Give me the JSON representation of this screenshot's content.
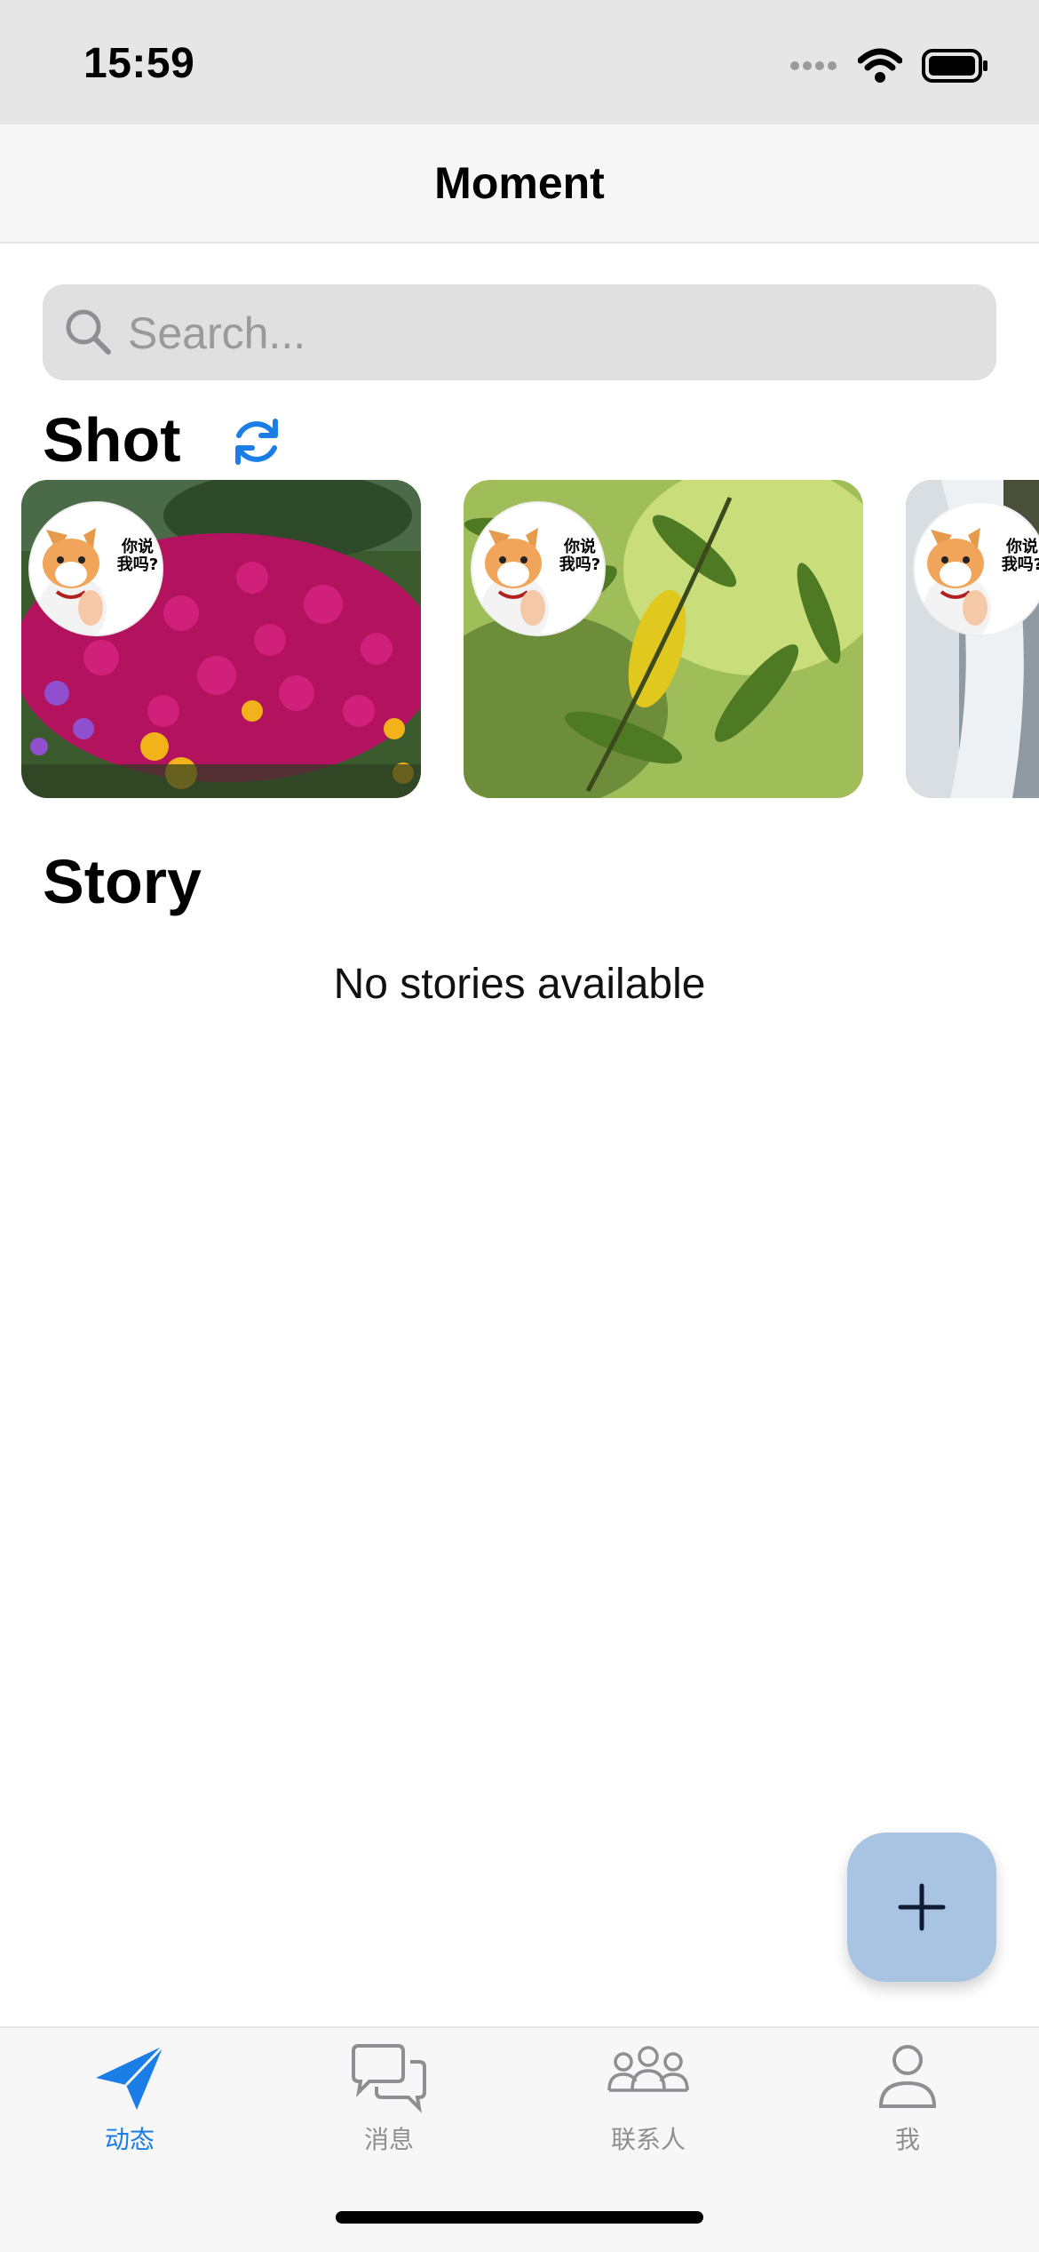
{
  "status_bar": {
    "time": "15:59"
  },
  "nav": {
    "title": "Moment"
  },
  "search": {
    "placeholder": "Search..."
  },
  "sections": {
    "shot": "Shot",
    "story": "Story"
  },
  "shots": [
    {
      "avatar_caption": "你说我吗?",
      "photo": "pink flowers"
    },
    {
      "avatar_caption": "你说我吗?",
      "photo": "green leaves"
    },
    {
      "avatar_caption": "你说我吗?",
      "photo": "waterfall"
    }
  ],
  "story": {
    "empty_message": "No stories available"
  },
  "fab": {
    "icon": "plus-icon"
  },
  "tabs": [
    {
      "label": "动态",
      "icon": "paper-plane-icon",
      "active": true
    },
    {
      "label": "消息",
      "icon": "chat-bubbles-icon",
      "active": false
    },
    {
      "label": "联系人",
      "icon": "people-icon",
      "active": false
    },
    {
      "label": "我",
      "icon": "person-icon",
      "active": false
    }
  ],
  "colors": {
    "accent": "#1a7ee6",
    "tab_inactive": "#8e8e93",
    "fab_bg": "#a9c4e3"
  }
}
